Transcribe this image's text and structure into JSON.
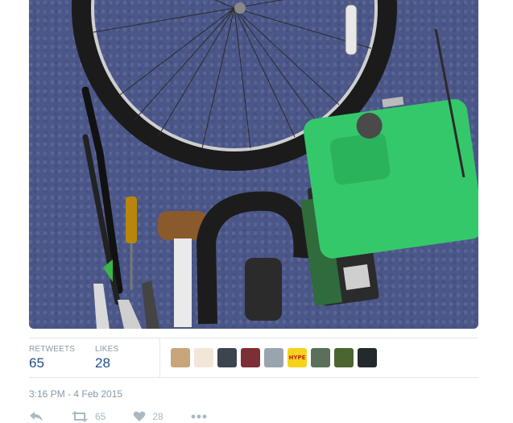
{
  "tweet": {
    "photo_icon": "tweet-photo",
    "stats": {
      "retweets_label": "RETWEETS",
      "retweets_value": "65",
      "likes_label": "LIKES",
      "likes_value": "28"
    },
    "avatars": [
      {
        "name": "avatar-1",
        "bg": "#c9a57a",
        "text": ""
      },
      {
        "name": "avatar-2",
        "bg": "#f2e6d8",
        "text": ""
      },
      {
        "name": "avatar-3",
        "bg": "#3c4450",
        "text": ""
      },
      {
        "name": "avatar-4",
        "bg": "#7c2f35",
        "text": ""
      },
      {
        "name": "avatar-5",
        "bg": "#9aa4ae",
        "text": ""
      },
      {
        "name": "avatar-6",
        "bg": "#f5d31b",
        "text": "HYPE"
      },
      {
        "name": "avatar-7",
        "bg": "#5b6f59",
        "text": ""
      },
      {
        "name": "avatar-8",
        "bg": "#4b6530",
        "text": ""
      },
      {
        "name": "avatar-9",
        "bg": "#242a2b",
        "text": ""
      }
    ],
    "timestamp": "3:16 PM - 4 Feb 2015",
    "actions": {
      "reply_icon": "reply-icon",
      "retweet_icon": "retweet-icon",
      "retweet_count": "65",
      "like_icon": "heart-icon",
      "like_count": "28",
      "more_icon": "more-icon"
    },
    "colors": {
      "count_blue": "#1f4d8a",
      "muted": "#8899a6",
      "border": "#e1e8ed"
    }
  }
}
